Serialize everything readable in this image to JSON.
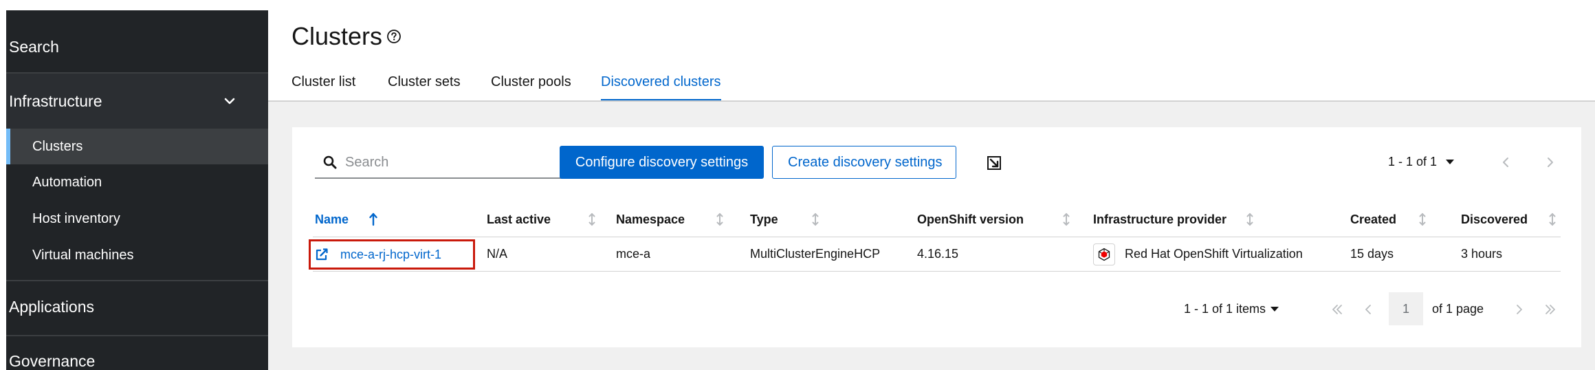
{
  "sidebar": {
    "search_label": "Search",
    "section": {
      "label": "Infrastructure",
      "expanded": true
    },
    "items": [
      {
        "label": "Clusters",
        "active": true
      },
      {
        "label": "Automation",
        "active": false
      },
      {
        "label": "Host inventory",
        "active": false
      },
      {
        "label": "Virtual machines",
        "active": false
      }
    ],
    "applications_label": "Applications",
    "governance_label": "Governance"
  },
  "header": {
    "title": "Clusters",
    "tabs": [
      {
        "label": "Cluster list",
        "active": false
      },
      {
        "label": "Cluster sets",
        "active": false
      },
      {
        "label": "Cluster pools",
        "active": false
      },
      {
        "label": "Discovered clusters",
        "active": true
      }
    ]
  },
  "toolbar": {
    "search_placeholder": "Search",
    "primary_button": "Configure discovery settings",
    "secondary_button": "Create discovery settings",
    "pagination_text": "1 - 1 of 1"
  },
  "table": {
    "columns": [
      "Name",
      "Last active",
      "Namespace",
      "Type",
      "OpenShift version",
      "Infrastructure provider",
      "Created",
      "Discovered"
    ],
    "sorted_column": "Name",
    "rows": [
      {
        "name": "mce-a-rj-hcp-virt-1",
        "last_active": "N/A",
        "namespace": "mce-a",
        "type": "MultiClusterEngineHCP",
        "openshift_version": "4.16.15",
        "infrastructure_provider": "Red Hat OpenShift Virtualization",
        "created": "15 days",
        "discovered": "3 hours"
      }
    ]
  },
  "pagination": {
    "items_text": "1 - 1 of 1 items",
    "current_page": "1",
    "of_pages_text": "of 1 page"
  },
  "colors": {
    "accent": "#0066cc",
    "sidebar_bg": "#212427",
    "highlight_border": "#c9190b"
  }
}
